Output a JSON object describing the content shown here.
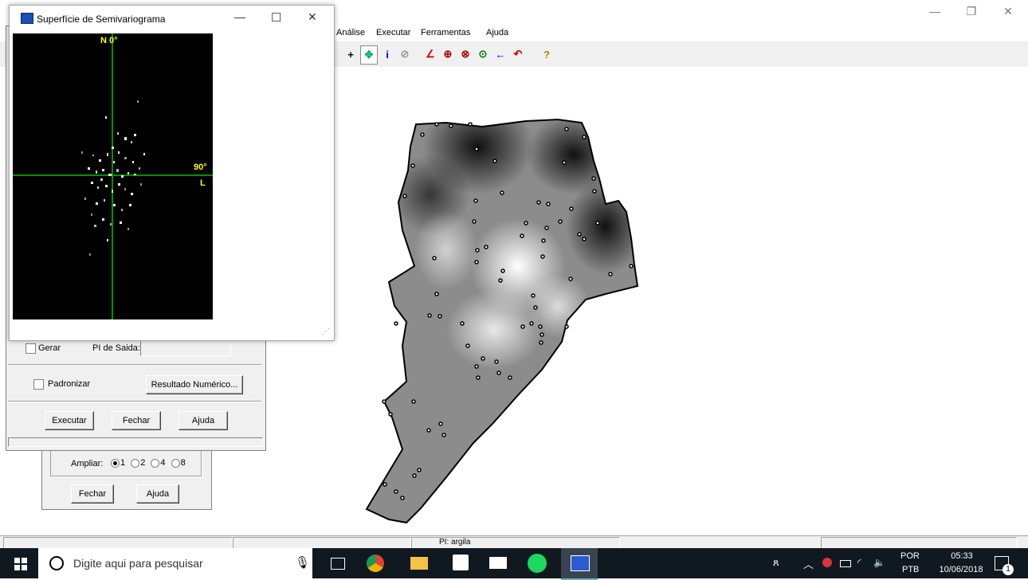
{
  "main_window": {
    "menu": [
      "Análise",
      "Executar",
      "Ferramentas",
      "Ajuda"
    ],
    "title_controls": {
      "minimize": "—",
      "restore": "❐",
      "close": "✕"
    }
  },
  "toolbar": {
    "buttons": [
      "+",
      "✥",
      "i",
      "⊘",
      "∠",
      "⊕",
      "⊗",
      "⊙",
      "←",
      "↶",
      "?"
    ]
  },
  "status_bar": {
    "pi_label": "PI: argila"
  },
  "semivariogram_window": {
    "title": "Superfície de Semivariograma",
    "north_label": "N 0°",
    "east_angle": "90°",
    "east_label": "L",
    "controls": {
      "minimize": "—",
      "maximize": "☐",
      "close": "✕"
    }
  },
  "parameters_dialog": {
    "gerar_label": "Gerar",
    "pi_saida_label": "PI de Saida:",
    "pi_saida_value": "",
    "padronizar_label": "Padronizar",
    "resultado_button": "Resultado Numérico...",
    "executar_button": "Executar",
    "fechar_button": "Fechar",
    "ajuda_button": "Ajuda"
  },
  "zoom_dialog": {
    "ampliar_label": "Ampliar:",
    "options": [
      "1",
      "2",
      "4",
      "8"
    ],
    "selected": "1",
    "fechar_button": "Fechar",
    "ajuda_button": "Ajuda"
  },
  "taskbar": {
    "search_placeholder": "Digite aqui para pesquisar",
    "language_top": "POR",
    "language_bottom": "PTB",
    "time": "05:33",
    "date": "10/06/2018",
    "notification_count": "1"
  }
}
